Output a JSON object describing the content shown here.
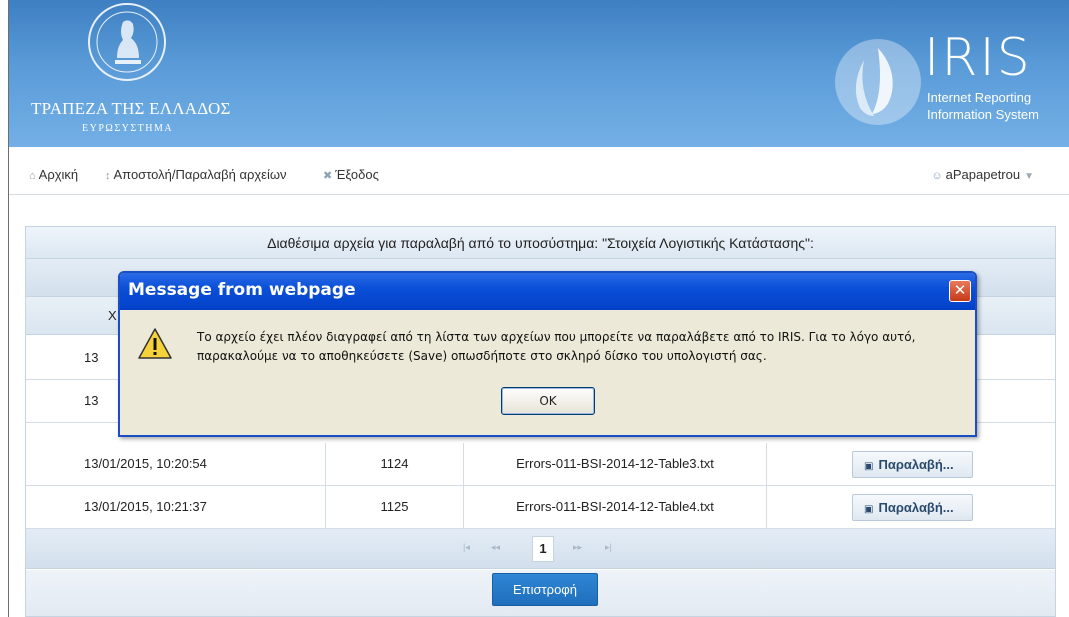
{
  "header": {
    "bank_name": "ΤΡΑΠΕΖΑ ΤΗΣ ΕΛΛΑΔΟΣ",
    "bank_sub": "ΕΥΡΩΣΥΣΤΗΜΑ",
    "iris_word": "IRIS",
    "iris_sub_line1": "Internet Reporting",
    "iris_sub_line2": "Information System"
  },
  "nav": {
    "home": "Αρχική",
    "transfer": "Αποστολή/Παραλαβή αρχείων",
    "logout": "Έξοδος",
    "user": "aPapapetrou"
  },
  "panel": {
    "title": "Διαθέσιμα αρχεία για παραλαβή από το υποσύστημα: \"Στοιχεία Λογιστικής Κατάστασης\":",
    "col_head_partial": "Χ",
    "rows": [
      {
        "date": "13",
        "id": "",
        "file": ""
      },
      {
        "date": "13",
        "id": "",
        "file": ""
      },
      {
        "date": "13/01/2015, 10:20:54",
        "id": "1124",
        "file": "Errors-011-BSI-2014-12-Table3.txt",
        "action": "Παραλαβή..."
      },
      {
        "date": "13/01/2015, 10:21:37",
        "id": "1125",
        "file": "Errors-011-BSI-2014-12-Table4.txt",
        "action": "Παραλαβή..."
      }
    ],
    "pager": {
      "first": "|◂",
      "prev": "◂◂",
      "current": "1",
      "next": "▸▸",
      "last": "▸|"
    },
    "back_button": "Επιστροφή"
  },
  "dialog": {
    "title": "Message from webpage",
    "close": "✕",
    "message_line1": "Το αρχείο έχει πλέον διαγραφεί από τη λίστα των αρχείων που μπορείτε να παραλάβετε από το IRIS. Για το λόγο αυτό,",
    "message_line2": "παρακαλούμε να το αποθηκεύσετε (Save) οπωσδήποτε στο σκληρό δίσκο του υπολογιστή σας.",
    "ok": "OK"
  },
  "colors": {
    "banner": "#4a8ccc",
    "dialog_title": "#0b50d8",
    "back_button": "#2278c8"
  }
}
